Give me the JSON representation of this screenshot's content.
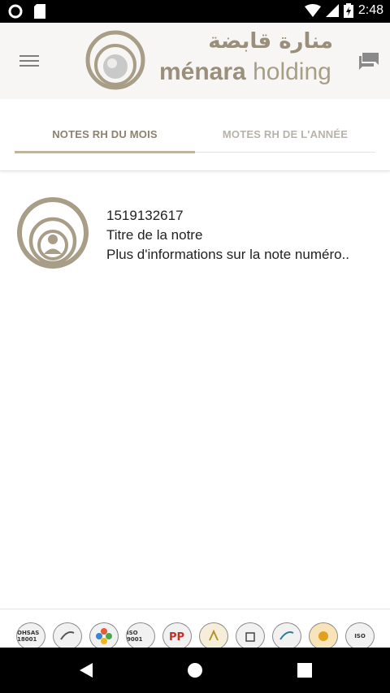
{
  "status_bar": {
    "time": "2:48",
    "battery_level": "90"
  },
  "header": {
    "brand_arabic": "منارة قابضة",
    "brand_primary": "ménara",
    "brand_secondary": " holding",
    "menu_icon": "hamburger-menu-icon",
    "chat_icon": "chat-bubbles-icon"
  },
  "tabs": [
    {
      "label": "NOTES RH DU MOIS",
      "active": true
    },
    {
      "label": "MOTES RH DE L'ANNÉE",
      "active": false
    }
  ],
  "notes": [
    {
      "id": "1519132617",
      "title": "Titre de la notre",
      "description": "Plus d'informations sur la note numéro.."
    }
  ],
  "footer": {
    "badges": [
      "OHSAS 18001",
      "",
      "",
      "ISO 9001",
      "",
      "",
      "",
      "",
      "",
      "ISO"
    ]
  },
  "colors": {
    "brand": "#9a8f7a",
    "brand_light": "#bfb59f",
    "tab_active": "#8c826e",
    "tab_inactive": "#b8b3aa"
  }
}
